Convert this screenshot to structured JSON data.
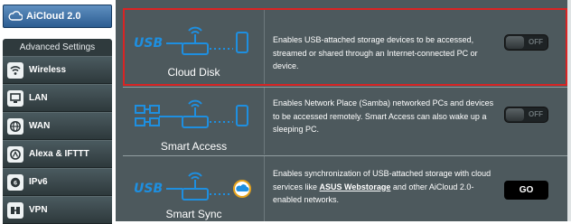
{
  "sidebar": {
    "aicloud_tab": "AiCloud 2.0",
    "advanced_header": "Advanced Settings",
    "items": [
      {
        "label": "Wireless",
        "icon": "wifi-icon"
      },
      {
        "label": "LAN",
        "icon": "monitor-icon"
      },
      {
        "label": "WAN",
        "icon": "globe-icon"
      },
      {
        "label": "Alexa & IFTTT",
        "icon": "alexa-icon"
      },
      {
        "label": "IPv6",
        "icon": "ipv6-icon"
      },
      {
        "label": "VPN",
        "icon": "vpn-icon"
      }
    ]
  },
  "features": [
    {
      "label": "Cloud Disk",
      "description": "Enables USB-attached storage devices to be accessed, streamed or shared through an Internet-connected PC or device.",
      "control": "OFF",
      "icon_badge": "USB"
    },
    {
      "label": "Smart Access",
      "description": "Enables Network Place (Samba) networked PCs and devices to be accessed remotely. Smart Access can also wake up a sleeping PC.",
      "control": "OFF"
    },
    {
      "label": "Smart Sync",
      "description_before": "Enables synchronization of USB-attached storage with cloud services like ",
      "description_link": "ASUS Webstorage",
      "description_after": " and other AiCloud 2.0-enabled networks.",
      "control": "GO",
      "icon_badge": "USB"
    }
  ],
  "colors": {
    "panel": "#4d595d",
    "highlight": "#d92424",
    "accent_blue": "#1e8fe0"
  }
}
